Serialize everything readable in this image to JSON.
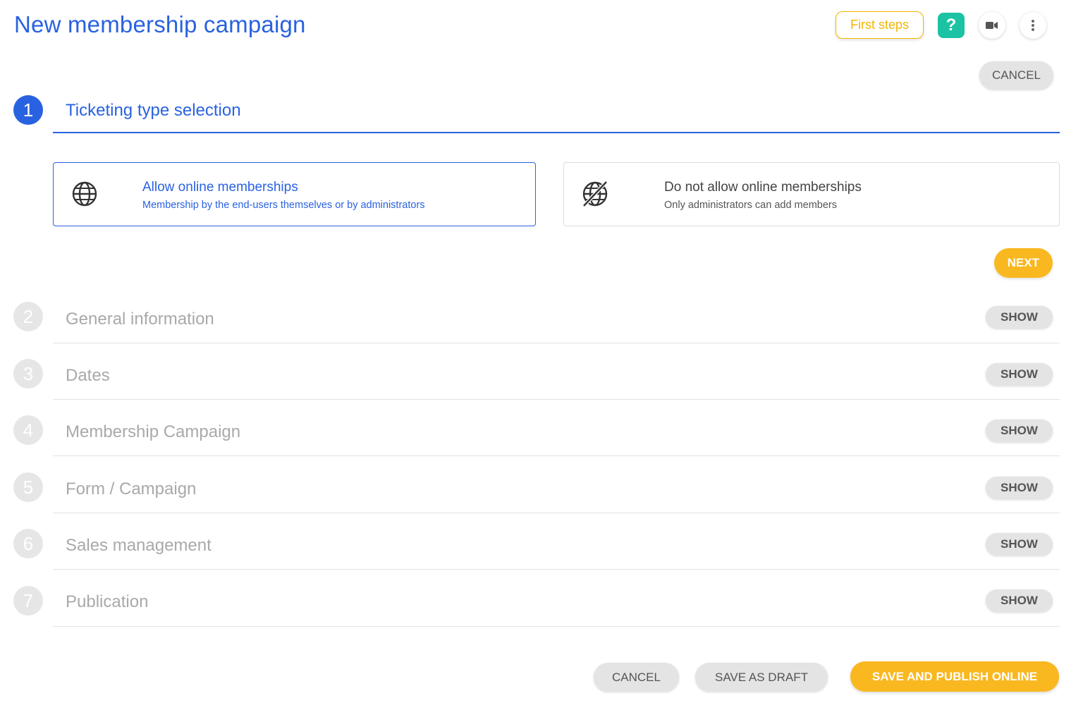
{
  "header": {
    "title": "New membership campaign",
    "first_steps_label": "First steps",
    "help_label": "?"
  },
  "top_cancel_label": "CANCEL",
  "steps": [
    {
      "number": "1",
      "title": "Ticketing type selection"
    },
    {
      "number": "2",
      "title": "General information",
      "action": "SHOW"
    },
    {
      "number": "3",
      "title": "Dates",
      "action": "SHOW"
    },
    {
      "number": "4",
      "title": "Membership Campaign",
      "action": "SHOW"
    },
    {
      "number": "5",
      "title": "Form / Campaign",
      "action": "SHOW"
    },
    {
      "number": "6",
      "title": "Sales management",
      "action": "SHOW"
    },
    {
      "number": "7",
      "title": "Publication",
      "action": "SHOW"
    }
  ],
  "options": [
    {
      "title": "Allow online memberships",
      "description": "Membership by the end-users themselves or by administrators",
      "selected": true,
      "icon": "globe-icon"
    },
    {
      "title": "Do not allow online memberships",
      "description": "Only administrators can add members",
      "selected": false,
      "icon": "globe-off-icon"
    }
  ],
  "next_label": "NEXT",
  "footer": {
    "cancel_label": "CANCEL",
    "draft_label": "SAVE AS DRAFT",
    "publish_label": "SAVE AND PUBLISH ONLINE"
  },
  "colors": {
    "primary": "#2962e0",
    "accent": "#f9b820",
    "help": "#1bc3a4",
    "inactive": "#a9a9a9"
  }
}
